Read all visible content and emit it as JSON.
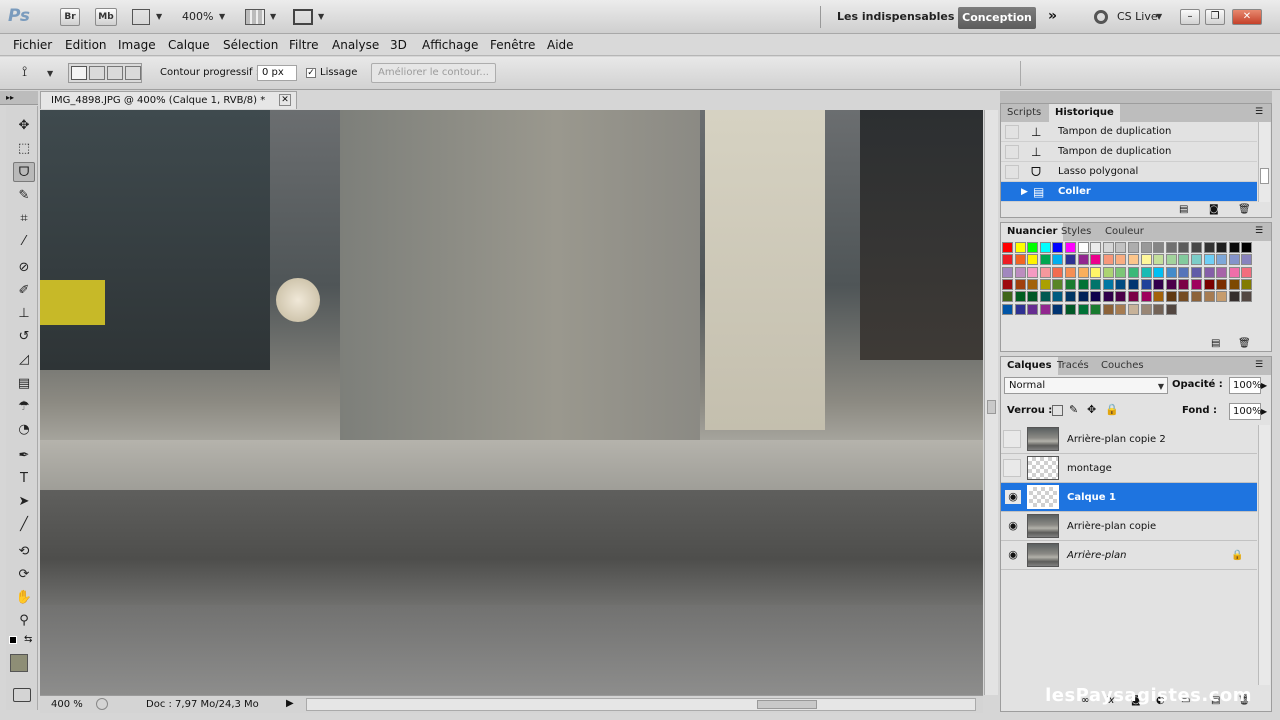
{
  "appbar": {
    "logo": "Ps",
    "bridge": "Br",
    "minibridge": "Mb",
    "zoom": "400%",
    "workspace_essentials": "Les indispensables",
    "workspace_active": "Conception",
    "cs_live": "CS Live"
  },
  "menu": [
    "Fichier",
    "Edition",
    "Image",
    "Calque",
    "Sélection",
    "Filtre",
    "Analyse",
    "3D",
    "Affichage",
    "Fenêtre",
    "Aide"
  ],
  "options": {
    "feather_label": "Contour progressif :",
    "feather_value": "0 px",
    "antialias_label": "Lissage",
    "antialias_checked": "✓",
    "refine_edge": "Améliorer le contour..."
  },
  "document": {
    "tab_title": "IMG_4898.JPG @ 400% (Calque 1, RVB/8) *",
    "status_zoom": "400 %",
    "status_doc": "Doc : 7,97 Mo/24,3 Mo"
  },
  "history_panel": {
    "tabs": [
      "Scripts",
      "Historique"
    ],
    "items": [
      "Tampon de duplication",
      "Tampon de duplication",
      "Lasso polygonal",
      "Coller"
    ]
  },
  "swatches_panel": {
    "tabs": [
      "Nuancier",
      "Styles",
      "Couleur"
    ],
    "rows": [
      [
        "#ff0000",
        "#ffff00",
        "#00ff00",
        "#00ffff",
        "#0000ff",
        "#ff00ff",
        "#ffffff",
        "#ebebeb",
        "#d6d6d6",
        "#c2c2c2",
        "#adadad",
        "#999999",
        "#858585",
        "#707070",
        "#5c5c5c",
        "#474747",
        "#333333",
        "#1f1f1f",
        "#0a0a0a",
        "#000000"
      ],
      [
        "#ed1c24",
        "#f26522",
        "#fff200",
        "#00a651",
        "#00aeef",
        "#2e3192",
        "#92278f",
        "#ec008c",
        "#f7977a",
        "#f9ad81",
        "#fdc68a",
        "#fff79a",
        "#c4df9b",
        "#a2d39c",
        "#82ca9d",
        "#7bcdc8",
        "#6ecff6",
        "#7ea7d8",
        "#8493ca",
        "#8882be"
      ],
      [
        "#a187be",
        "#bc8dbf",
        "#f49ac2",
        "#f6989d",
        "#f26c4f",
        "#f68e55",
        "#fbaf5c",
        "#fff467",
        "#acd372",
        "#7cc576",
        "#3bb878",
        "#1abbb4",
        "#00bff3",
        "#438cca",
        "#5574b9",
        "#605ca8",
        "#855fa8",
        "#a763a8",
        "#f06ea9",
        "#f26d7d"
      ],
      [
        "#9e0b0f",
        "#a0410d",
        "#a3620a",
        "#aba000",
        "#598527",
        "#1a7b30",
        "#007236",
        "#00746b",
        "#0076a3",
        "#004a80",
        "#003471",
        "#21409a",
        "#32004b",
        "#4b0049",
        "#7b0046",
        "#9e005d",
        "#790000",
        "#7b2e00",
        "#7d4900",
        "#827b00"
      ],
      [
        "#406618",
        "#005e20",
        "#005826",
        "#005952",
        "#005b7f",
        "#003663",
        "#002157",
        "#0d004c",
        "#30004a",
        "#4b0049",
        "#7b0046",
        "#9e005d",
        "#a3620a",
        "#603913",
        "#754c24",
        "#8c6239",
        "#a67c52",
        "#c69c6d",
        "#362f2d",
        "#534741"
      ],
      [
        "#0054a6",
        "#2e3192",
        "#662d91",
        "#92278f",
        "#003471",
        "#005826",
        "#007236",
        "#197b30",
        "#8c6239",
        "#a67c52",
        "#c7b299",
        "#998675",
        "#736357",
        "#534741"
      ]
    ]
  },
  "layers_panel": {
    "tabs": [
      "Calques",
      "Tracés",
      "Couches"
    ],
    "blend_mode": "Normal",
    "opacity_label": "Opacité :",
    "opacity_value": "100%",
    "lock_label": "Verrou :",
    "fill_label": "Fond :",
    "fill_value": "100%",
    "layers": [
      {
        "name": "Arrière-plan copie 2",
        "visible": false,
        "thumb": "photo"
      },
      {
        "name": "montage",
        "visible": false,
        "thumb": "transparent"
      },
      {
        "name": "Calque 1",
        "visible": true,
        "thumb": "transparent"
      },
      {
        "name": "Arrière-plan copie",
        "visible": true,
        "thumb": "photo"
      },
      {
        "name": "Arrière-plan",
        "visible": true,
        "thumb": "photo"
      }
    ]
  },
  "watermark": "lesPaysagistes.com"
}
